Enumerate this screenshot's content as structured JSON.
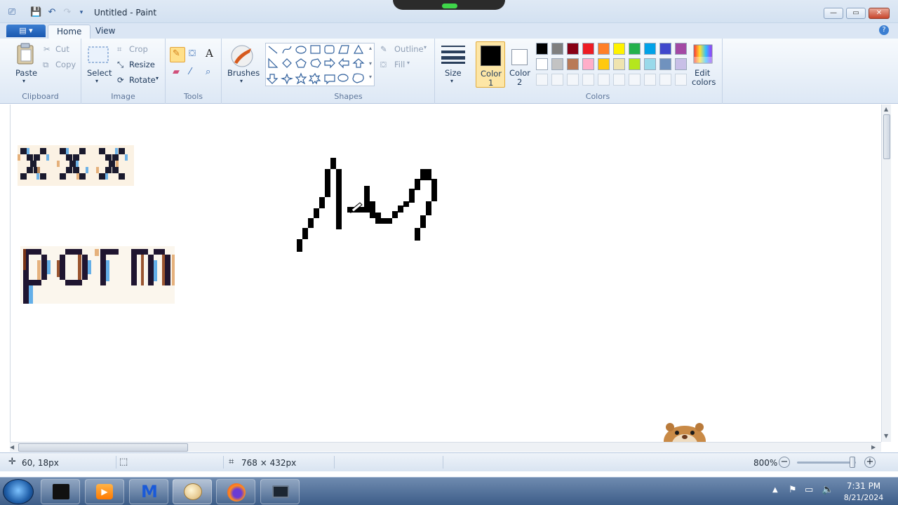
{
  "window": {
    "title": "Untitled - Paint",
    "qat": {
      "save_icon": "save-icon",
      "undo_icon": "undo-icon",
      "redo_icon": "redo-icon",
      "customize_icon": "chevron-down-icon"
    }
  },
  "tabs": [
    {
      "label": "Home",
      "active": true
    },
    {
      "label": "View",
      "active": false
    }
  ],
  "ribbon": {
    "clipboard": {
      "group_label": "Clipboard",
      "paste": "Paste",
      "cut": "Cut",
      "copy": "Copy"
    },
    "image": {
      "group_label": "Image",
      "select": "Select",
      "crop": "Crop",
      "resize": "Resize",
      "rotate": "Rotate"
    },
    "tools": {
      "group_label": "Tools"
    },
    "brushes": {
      "label": "Brushes"
    },
    "shapes": {
      "group_label": "Shapes",
      "outline": "Outline",
      "fill": "Fill"
    },
    "size": {
      "label": "Size"
    },
    "color1": {
      "label": "Color",
      "num": "1",
      "value": "#000000"
    },
    "color2": {
      "label": "Color",
      "num": "2",
      "value": "#ffffff"
    },
    "colors": {
      "group_label": "Colors",
      "edit_label": "Edit",
      "edit_label2": "colors",
      "palette_row1": [
        "#000000",
        "#7f7f7f",
        "#880015",
        "#ed1c24",
        "#ff7f27",
        "#fff200",
        "#22b14c",
        "#00a2e8",
        "#3f48cc",
        "#a349a4"
      ],
      "palette_row2": [
        "#ffffff",
        "#c3c3c3",
        "#b97a57",
        "#ffaec9",
        "#ffc90e",
        "#efe4b0",
        "#b5e61d",
        "#99d9ea",
        "#7092be",
        "#c8bfe7"
      ]
    }
  },
  "status": {
    "cursor_pos": "60, 18px",
    "image_size": "768 × 432px",
    "zoom": "800%",
    "zoom_level": 0.97
  },
  "taskbar": {
    "time": "7:31 PM",
    "date": "8/21/2024"
  }
}
